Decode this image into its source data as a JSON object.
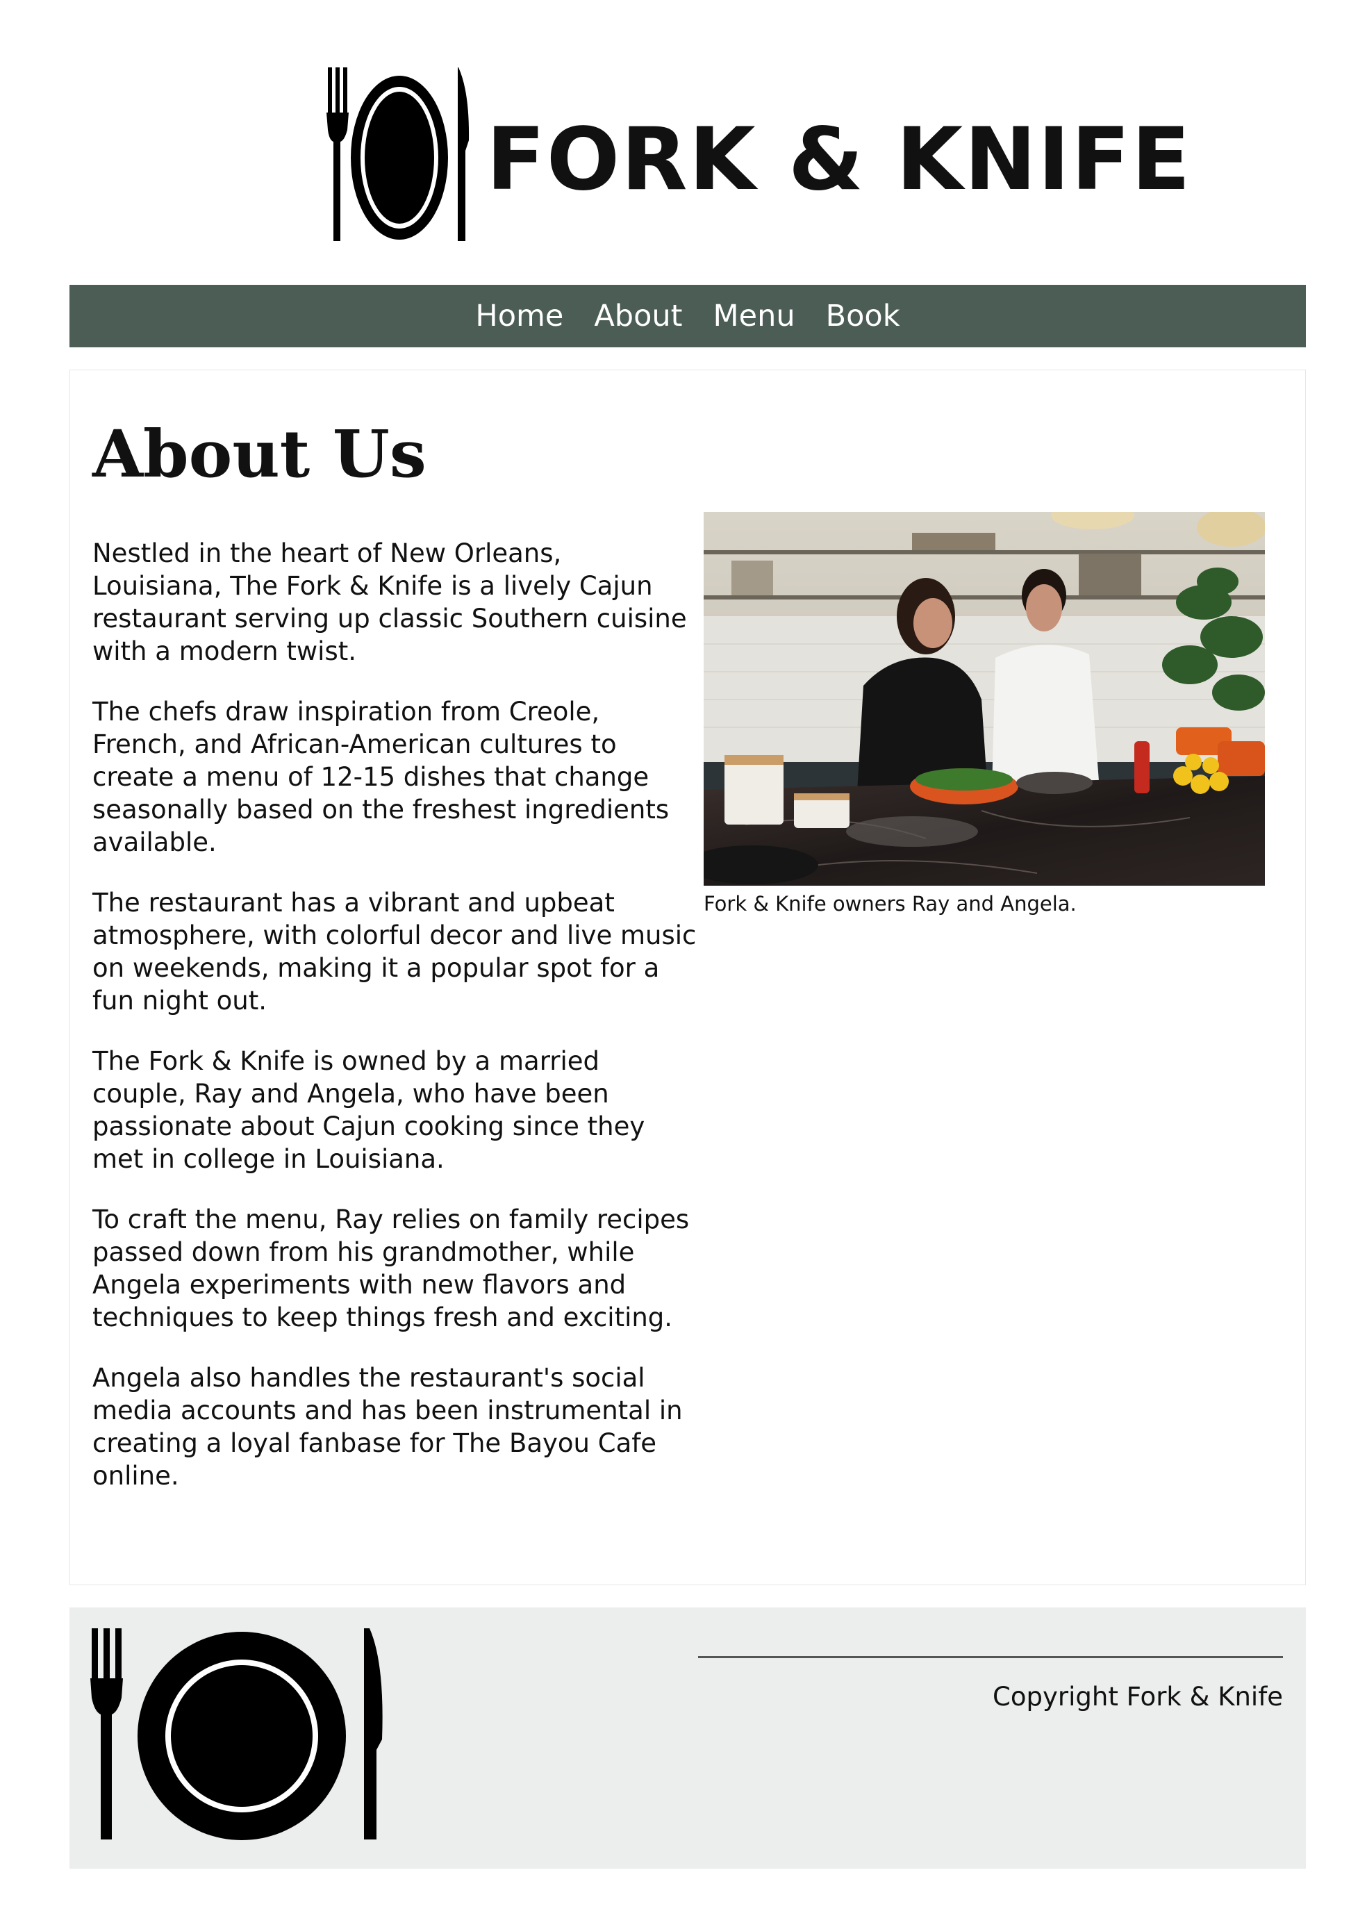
{
  "brand": {
    "name": "FORK & KNIFE",
    "logo_icon": "fork-plate-knife-icon"
  },
  "nav": {
    "items": [
      {
        "label": "Home"
      },
      {
        "label": "About"
      },
      {
        "label": "Menu"
      },
      {
        "label": "Book"
      }
    ]
  },
  "main": {
    "title": "About Us",
    "paragraphs": [
      "Nestled in the heart of New Orleans, Louisiana, The Fork & Knife is a lively Cajun restaurant serving up classic Southern cuisine with a modern twist.",
      "The chefs draw inspiration from Creole, French, and African-American cultures to create a menu of 12-15 dishes that change seasonally based on the freshest ingredients available.",
      "The restaurant has a vibrant and upbeat atmosphere, with colorful decor and live music on weekends, making it a popular spot for a fun night out.",
      "The Fork & Knife is owned by a married couple, Ray and Angela, who have been passionate about Cajun cooking since they met in college in Louisiana.",
      "To craft the menu, Ray relies on family recipes passed down from his grandmother, while Angela experiments with new flavors and techniques to keep things fresh and exciting.",
      "Angela also handles the restaurant's social media accounts and has been instrumental in creating a loyal fanbase for The Bayou Cafe online."
    ],
    "figure": {
      "caption": "Fork & Knife owners Ray and Angela."
    }
  },
  "footer": {
    "logo_icon": "fork-plate-knife-icon",
    "copyright": "Copyright Fork & Knife"
  },
  "colors": {
    "nav_background": "#4b5d55",
    "nav_text": "#ffffff",
    "footer_background": "#eceeed",
    "text": "#111111"
  }
}
